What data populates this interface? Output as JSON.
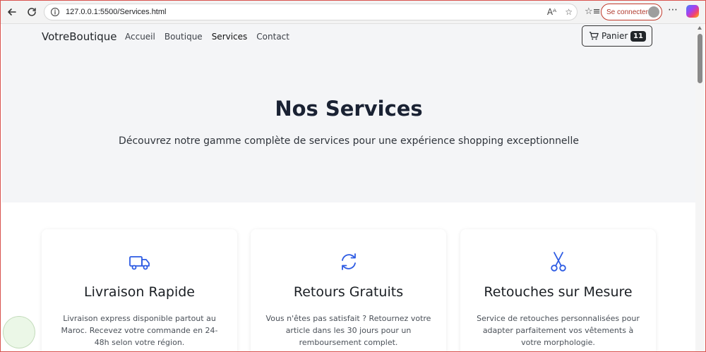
{
  "browser": {
    "url": "127.0.0.1:5500/Services.html",
    "signin_label": "Se connecter",
    "read_aloud": "A̅",
    "more_label": "⋯"
  },
  "navbar": {
    "brand": "VotreBoutique",
    "menu": [
      {
        "label": "Accueil"
      },
      {
        "label": "Boutique"
      },
      {
        "label": "Services"
      },
      {
        "label": "Contact"
      }
    ],
    "cart_label": "Panier",
    "cart_count": "11"
  },
  "hero": {
    "title": "Nos Services",
    "subtitle": "Découvrez notre gamme complète de services pour une expérience shopping exceptionnelle"
  },
  "services": [
    {
      "icon": "truck-icon",
      "title": "Livraison Rapide",
      "desc": "Livraison express disponible partout au Maroc. Recevez votre commande en 24-48h selon votre région."
    },
    {
      "icon": "sync-icon",
      "title": "Retours Gratuits",
      "desc": "Vous n'êtes pas satisfait ? Retournez votre article dans les 30 jours pour un remboursement complet."
    },
    {
      "icon": "scissors-icon",
      "title": "Retouches sur Mesure",
      "desc": "Service de retouches personnalisées pour adapter parfaitement vos vêtements à votre morphologie."
    }
  ],
  "colors": {
    "accent": "#2d5be3",
    "hero_bg": "#f4f5f7",
    "dark": "#212529"
  }
}
